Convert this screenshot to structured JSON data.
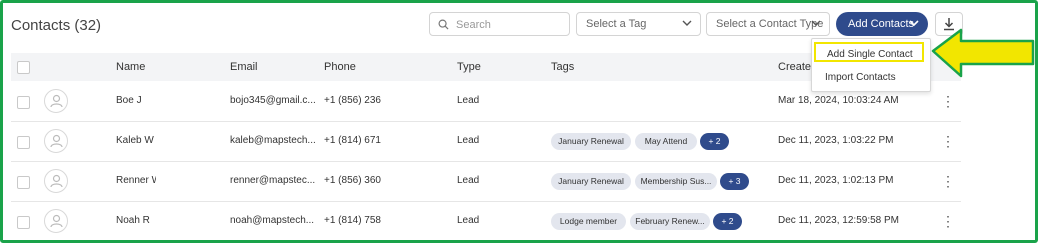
{
  "header": {
    "title": "Contacts (32)",
    "search_placeholder": "Search",
    "tag_select": "Select a Tag",
    "type_select": "Select a Contact Type",
    "add_button": "Add Contacts",
    "download_icon": "download-icon"
  },
  "columns": [
    "Name",
    "Email",
    "Phone",
    "Type",
    "Tags",
    "Create"
  ],
  "menu": {
    "items": [
      "Add Single Contact",
      "Import Contacts"
    ]
  },
  "rows": [
    {
      "name": "Boe J",
      "email": "bojo345@gmail.c...",
      "phone": "+1 (856) 236",
      "type": "Lead",
      "tags": [],
      "more": "",
      "created": "Mar 18, 2024, 10:03:24 AM"
    },
    {
      "name": "Kaleb W",
      "email": "kaleb@mapstech...",
      "phone": "+1 (814) 671",
      "type": "Lead",
      "tags": [
        "January Renewal",
        "May Attend"
      ],
      "more": "+ 2",
      "created": "Dec 11, 2023, 1:03:22 PM"
    },
    {
      "name": "Renner W",
      "email": "renner@mapstec...",
      "phone": "+1 (856) 360",
      "type": "Lead",
      "tags": [
        "January Renewal",
        "Membership Sus..."
      ],
      "more": "+ 3",
      "created": "Dec 11, 2023, 1:02:13 PM"
    },
    {
      "name": "Noah R",
      "email": "noah@mapstech...",
      "phone": "+1 (814) 758",
      "type": "Lead",
      "tags": [
        "Lodge member",
        "February Renew..."
      ],
      "more": "+ 2",
      "created": "Dec 11, 2023, 12:59:58 PM"
    }
  ],
  "colors": {
    "frame": "#1aa34a",
    "accent": "#2f4b8c",
    "highlight": "#f2e600"
  }
}
